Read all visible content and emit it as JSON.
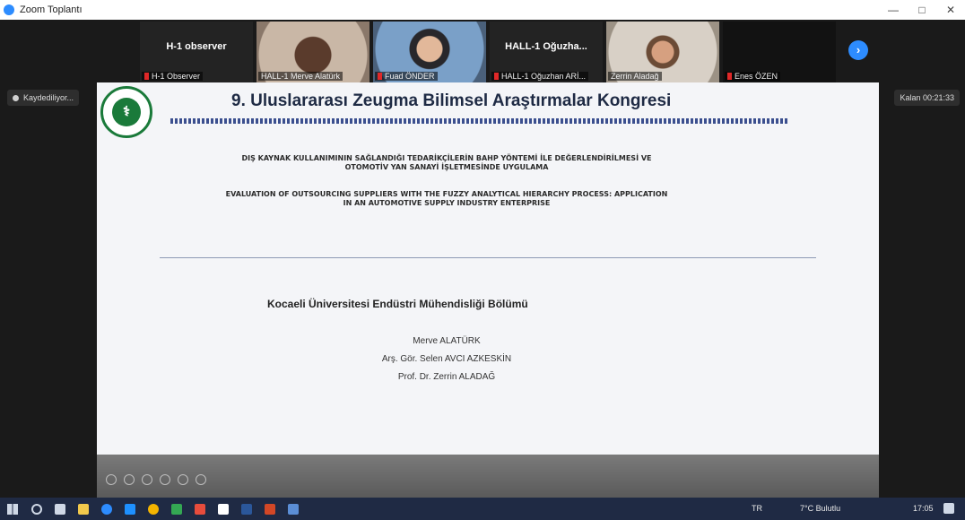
{
  "window": {
    "title": "Zoom Toplantı",
    "minimize": "—",
    "maximize": "□",
    "close": "✕"
  },
  "participants": [
    {
      "name": "H-1 observer",
      "caption": "H-1 Observer",
      "video": false
    },
    {
      "name": "",
      "caption": "HALL-1 Merve Alatürk",
      "video": true
    },
    {
      "name": "",
      "caption": "Fuad ÖNDER",
      "video": true
    },
    {
      "name": "HALL-1 Oğuzha...",
      "caption": "HALL-1 Oğuzhan ARİ...",
      "video": false
    },
    {
      "name": "",
      "caption": "Zerrin Aladağ",
      "video": true
    },
    {
      "name": "",
      "caption": "Enes ÖZEN",
      "video": false
    }
  ],
  "recording": "Kaydediliyor...",
  "timer": "Kalan 00:21:33",
  "slide": {
    "title": "9. Uluslararası Zeugma Bilimsel Araştırmalar Kongresi",
    "turkish_title": "DIŞ KAYNAK KULLANIMININ SAĞLANDIĞI TEDARİKÇİLERİN BAHP YÖNTEMİ İLE DEĞERLENDİRİLMESİ VE OTOMOTİV YAN SANAYİ İŞLETMESİNDE UYGULAMA",
    "english_title": "EVALUATION OF OUTSOURCING SUPPLIERS WITH THE FUZZY ANALYTICAL HIERARCHY PROCESS: APPLICATION IN AN AUTOMOTIVE SUPPLY INDUSTRY ENTERPRISE",
    "department": "Kocaeli Üniversitesi Endüstri Mühendisliği Bölümü",
    "authors": [
      "Merve ALATÜRK",
      "Arş. Gör. Selen AVCI AZKESKİN",
      "Prof. Dr. Zerrin ALADAĞ"
    ]
  },
  "taskbar": {
    "lang": "TR",
    "weather": "7°C Bulutlu",
    "time": "17:05"
  },
  "colors": {
    "zoom_blue": "#2d8cff",
    "university_green": "#1a7a3a",
    "slide_title": "#1e2a44",
    "taskbar": "#1f2a44",
    "mic_muted": "#e02828"
  }
}
